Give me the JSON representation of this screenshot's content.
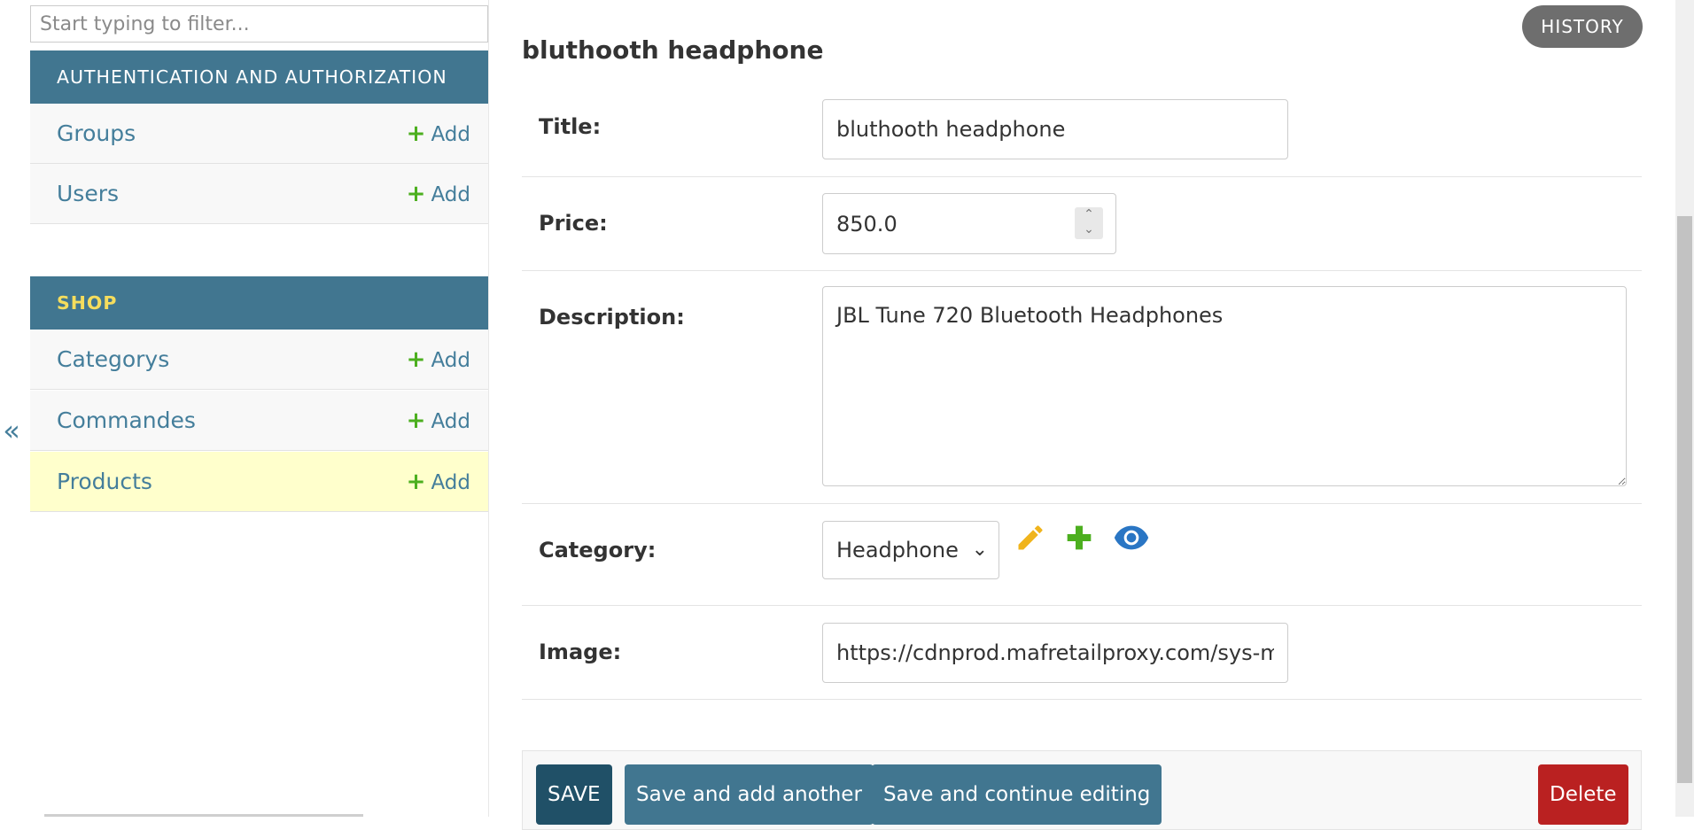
{
  "sidebar": {
    "filter_placeholder": "Start typing to filter...",
    "toggle_glyph": "«",
    "modules": [
      {
        "caption": "AUTHENTICATION AND AUTHORIZATION",
        "models": [
          {
            "name": "Groups",
            "add_label": "Add"
          },
          {
            "name": "Users",
            "add_label": "Add"
          }
        ]
      },
      {
        "caption": "SHOP",
        "models": [
          {
            "name": "Categorys",
            "add_label": "Add"
          },
          {
            "name": "Commandes",
            "add_label": "Add"
          },
          {
            "name": "Products",
            "add_label": "Add",
            "current": true
          }
        ]
      }
    ]
  },
  "header": {
    "history_label": "HISTORY",
    "title": "bluthooth headphone"
  },
  "form": {
    "title": {
      "label": "Title:",
      "value": "bluthooth headphone"
    },
    "price": {
      "label": "Price:",
      "value": "850.0"
    },
    "description": {
      "label": "Description:",
      "value": "JBL Tune 720 Bluetooth Headphones"
    },
    "category": {
      "label": "Category:",
      "value": "Headphone"
    },
    "image": {
      "label": "Image:",
      "value": "https://cdnprod.mafretailproxy.com/sys-ma"
    }
  },
  "submit": {
    "save_label": "SAVE",
    "save_add_label": "Save and add another",
    "save_continue_label": "Save and continue editing",
    "delete_label": "Delete"
  },
  "icons": {
    "change": "pencil-icon",
    "add": "plus-icon",
    "view": "eye-icon"
  },
  "colors": {
    "module_header": "#417690",
    "link": "#447e9b",
    "current_row": "#ffffcc",
    "add_green": "#4caf1f",
    "delete_red": "#ba2121",
    "save_dark": "#205067"
  }
}
